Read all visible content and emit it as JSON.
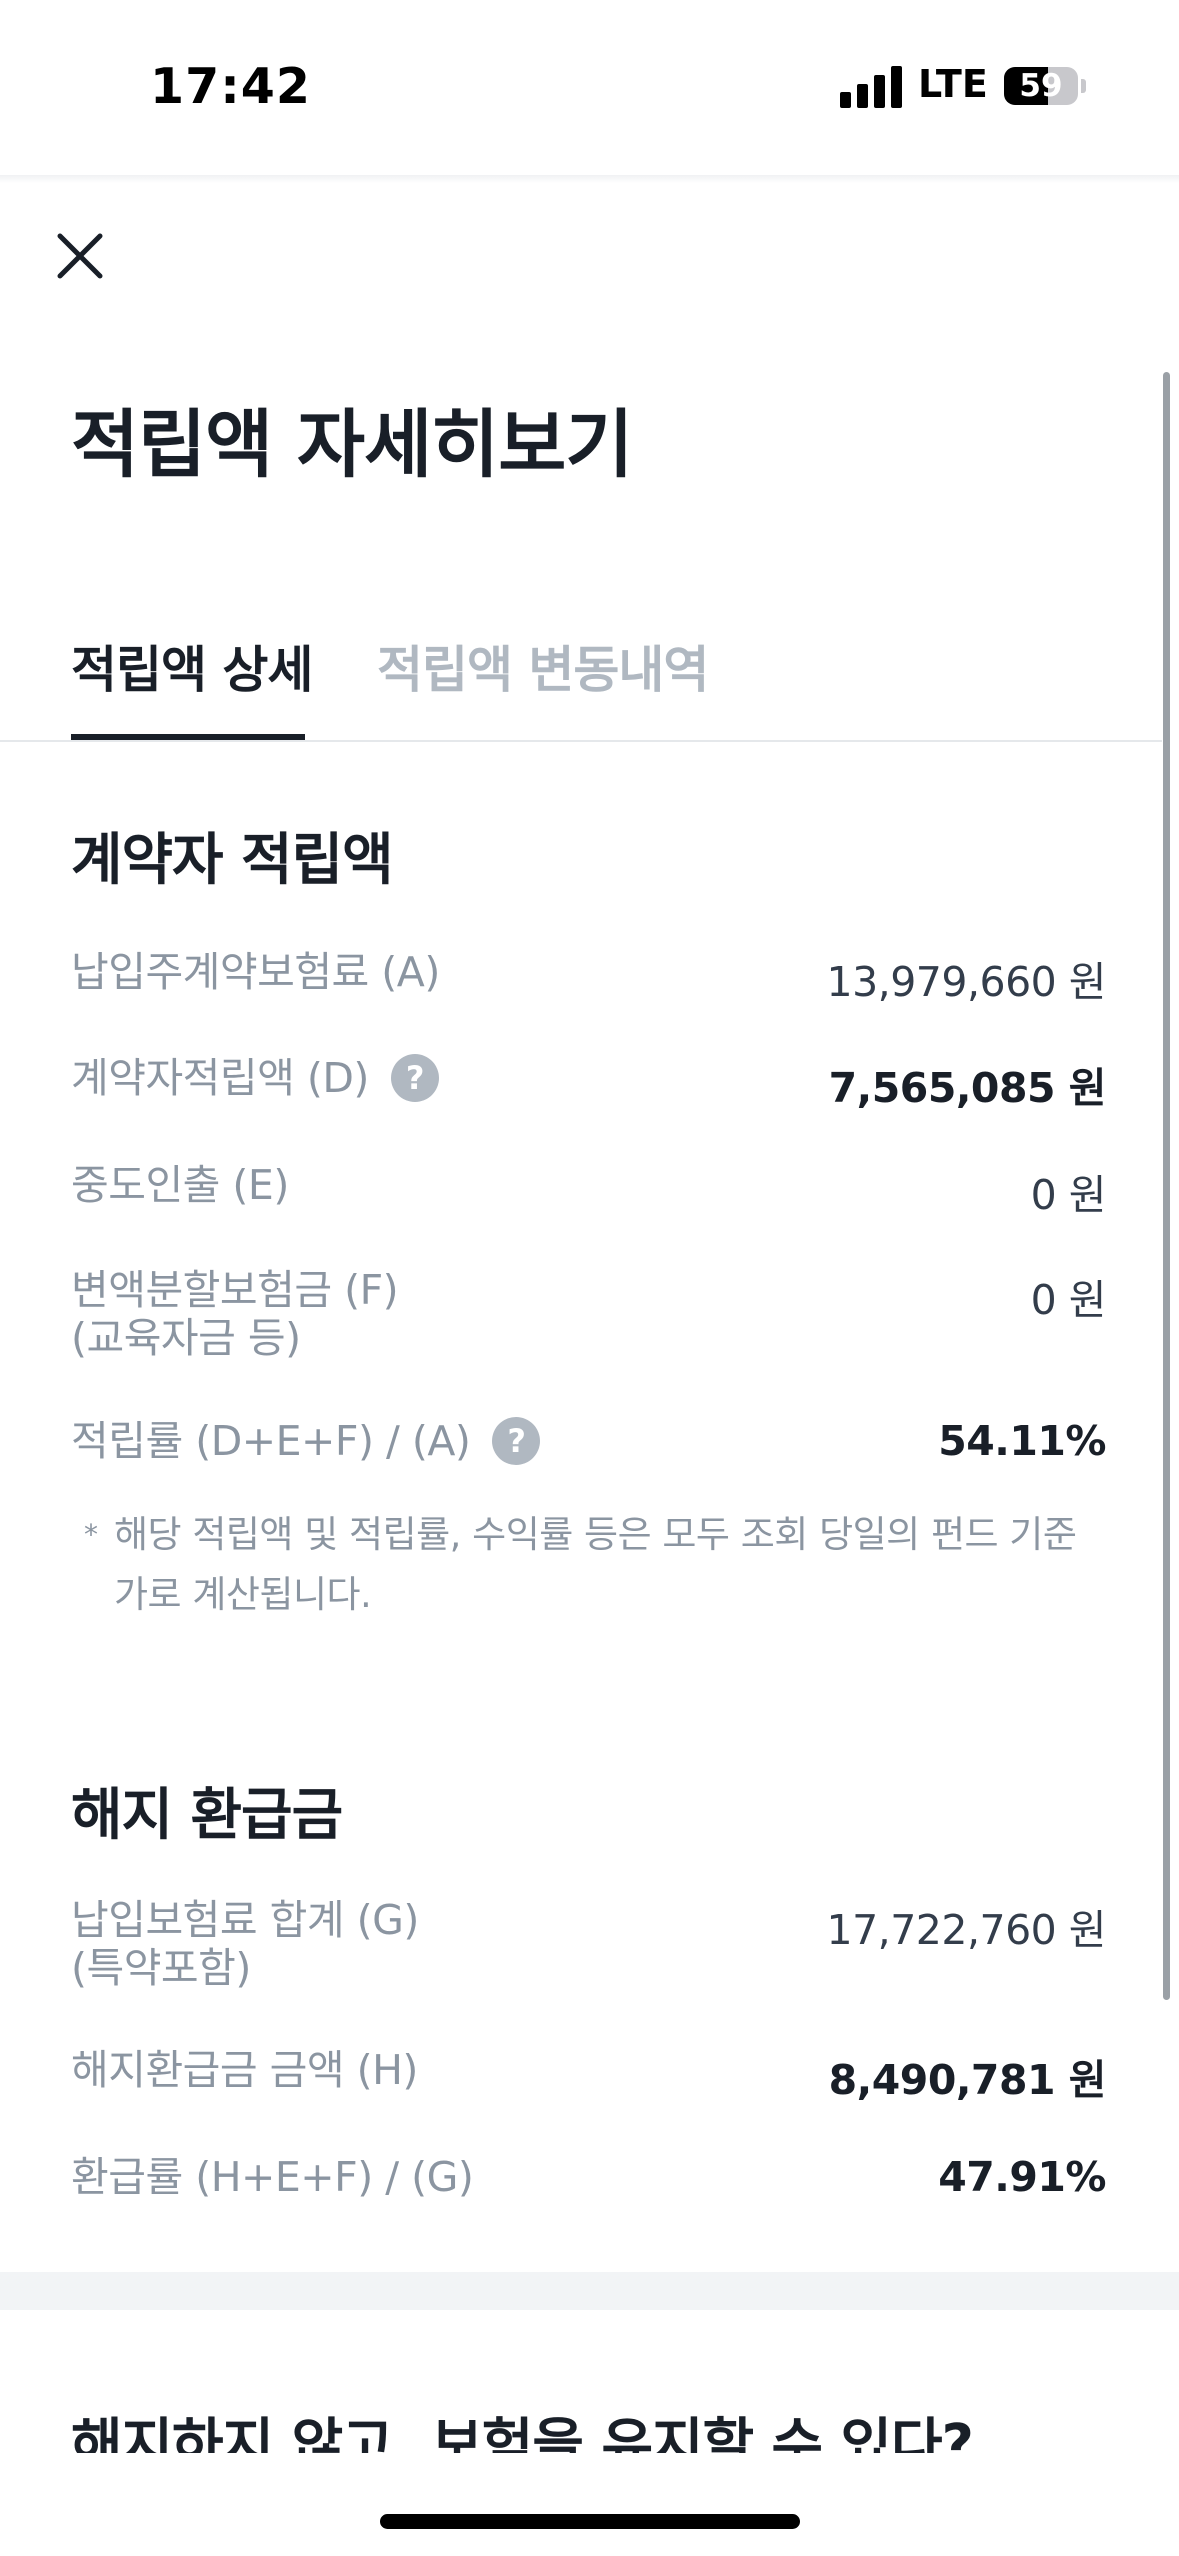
{
  "status_bar": {
    "time": "17:42",
    "network": "LTE",
    "battery": "59",
    "battery_level": 0.59,
    "icons": [
      "signal-icon",
      "battery-icon"
    ]
  },
  "header": {
    "close_icon": "close-icon",
    "title": "적립액 자세히보기"
  },
  "tabs": [
    {
      "label": "적립액 상세",
      "active": true
    },
    {
      "label": "적립액 변동내역",
      "active": false
    }
  ],
  "contractor_section": {
    "title": "계약자 적립액",
    "rows": [
      {
        "label": "납입주계약보험료 (A)",
        "value": "13,979,660 원"
      },
      {
        "label": "계약자적립액 (D)",
        "value": "7,565,085 원",
        "help": "?"
      },
      {
        "label": "중도인출 (E)",
        "value": "0 원"
      },
      {
        "label": "변액분할보험금 (F)",
        "label2": "(교육자금 등)",
        "value": "0 원"
      },
      {
        "label": "적립률 (D+E+F) / (A)",
        "value": "54.11%",
        "help": "?"
      }
    ],
    "note_mark": "*",
    "note": "해당 적립액 및 적립률, 수익률 등은 모두 조회 당일의 펀드 기준가로 계산됩니다."
  },
  "refund_section": {
    "title": "해지 환급금",
    "rows": [
      {
        "label": "납입보험료 합계 (G)",
        "label2": "(특약포함)",
        "value": "17,722,760 원"
      },
      {
        "label": "해지환급금 금액 (H)",
        "value": "8,490,781 원"
      },
      {
        "label": "환급률 (H+E+F) / (G)",
        "value": "47.91%"
      }
    ]
  },
  "bottom": {
    "heading": "해지하지 않고, 보험을 유지할 수 있다?"
  },
  "colors": {
    "text_primary": "#191f28",
    "text_secondary": "#8b95a1",
    "tab_inactive": "#b0b8c1",
    "divider": "#e5e8eb",
    "help_icon_bg": "#b0b8c1",
    "band": "#f2f4f6"
  }
}
